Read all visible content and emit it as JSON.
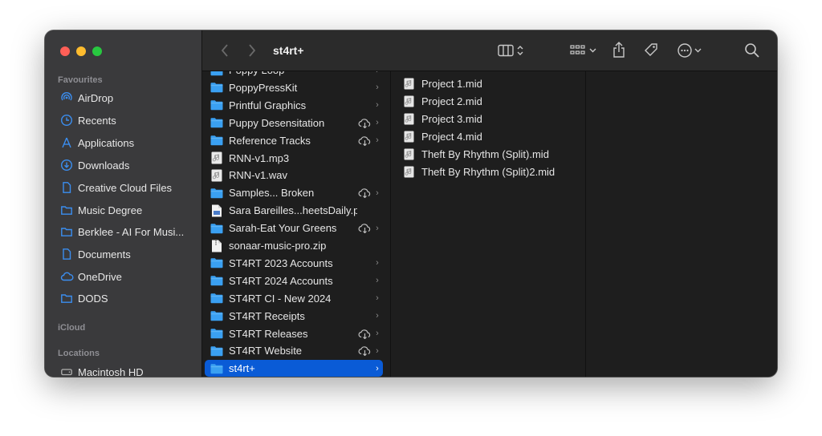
{
  "window": {
    "title": "st4rt+"
  },
  "sidebar": {
    "favourites_label": "Favourites",
    "favourites": [
      {
        "label": "AirDrop",
        "icon": "airdrop-icon"
      },
      {
        "label": "Recents",
        "icon": "clock-icon"
      },
      {
        "label": "Applications",
        "icon": "applications-icon"
      },
      {
        "label": "Downloads",
        "icon": "download-icon"
      },
      {
        "label": "Creative Cloud Files",
        "icon": "document-icon"
      },
      {
        "label": "Music Degree",
        "icon": "folder-icon"
      },
      {
        "label": "Berklee - AI For Musi...",
        "icon": "folder-icon"
      },
      {
        "label": "Documents",
        "icon": "document-icon"
      },
      {
        "label": "OneDrive",
        "icon": "cloud-icon"
      },
      {
        "label": "DODS",
        "icon": "folder-icon"
      }
    ],
    "icloud_label": "iCloud",
    "locations_label": "Locations",
    "locations": [
      {
        "label": "Macintosh HD",
        "icon": "disk-icon"
      }
    ]
  },
  "column1": {
    "items": [
      {
        "label": "Poppy Loop",
        "type": "folder",
        "cloud": false,
        "chevron": true
      },
      {
        "label": "PoppyPressKit",
        "type": "folder",
        "cloud": false,
        "chevron": true
      },
      {
        "label": "Printful Graphics",
        "type": "folder",
        "cloud": false,
        "chevron": true
      },
      {
        "label": "Puppy Desensitation",
        "type": "folder",
        "cloud": true,
        "chevron": true
      },
      {
        "label": "Reference Tracks",
        "type": "folder",
        "cloud": true,
        "chevron": true
      },
      {
        "label": "RNN-v1.mp3",
        "type": "audio",
        "cloud": false,
        "chevron": false
      },
      {
        "label": "RNN-v1.wav",
        "type": "audio",
        "cloud": false,
        "chevron": false
      },
      {
        "label": "Samples... Broken",
        "type": "folder",
        "cloud": true,
        "chevron": true
      },
      {
        "label": "Sara Bareilles...heetsDaily.pdf",
        "type": "pdf",
        "cloud": false,
        "chevron": false
      },
      {
        "label": "Sarah-Eat Your Greens",
        "type": "folder",
        "cloud": true,
        "chevron": true
      },
      {
        "label": "sonaar-music-pro.zip",
        "type": "zip",
        "cloud": false,
        "chevron": false
      },
      {
        "label": "ST4RT 2023 Accounts",
        "type": "folder",
        "cloud": false,
        "chevron": true
      },
      {
        "label": "ST4RT 2024 Accounts",
        "type": "folder",
        "cloud": false,
        "chevron": true
      },
      {
        "label": "ST4RT CI - New 2024",
        "type": "folder",
        "cloud": false,
        "chevron": true
      },
      {
        "label": "ST4RT Receipts",
        "type": "folder",
        "cloud": false,
        "chevron": true
      },
      {
        "label": "ST4RT Releases",
        "type": "folder",
        "cloud": true,
        "chevron": true
      },
      {
        "label": "ST4RT Website",
        "type": "folder",
        "cloud": true,
        "chevron": true
      },
      {
        "label": "st4rt+",
        "type": "folder",
        "cloud": false,
        "chevron": true,
        "selected": true
      }
    ]
  },
  "column2": {
    "items": [
      {
        "label": "Project 1.mid"
      },
      {
        "label": "Project 2.mid"
      },
      {
        "label": "Project 3.mid"
      },
      {
        "label": "Project 4.mid"
      },
      {
        "label": "Theft By Rhythm (Split).mid"
      },
      {
        "label": "Theft By Rhythm (Split)2.mid"
      }
    ]
  },
  "toolbar": {
    "icons": [
      "back-icon",
      "forward-icon",
      "column-view-icon",
      "group-icon",
      "share-icon",
      "tag-icon",
      "more-icon",
      "search-icon"
    ]
  },
  "colors": {
    "accent": "#0a5bd6",
    "folder": "#3aa0f2",
    "sidebar_icon": "#3b8ef0"
  }
}
